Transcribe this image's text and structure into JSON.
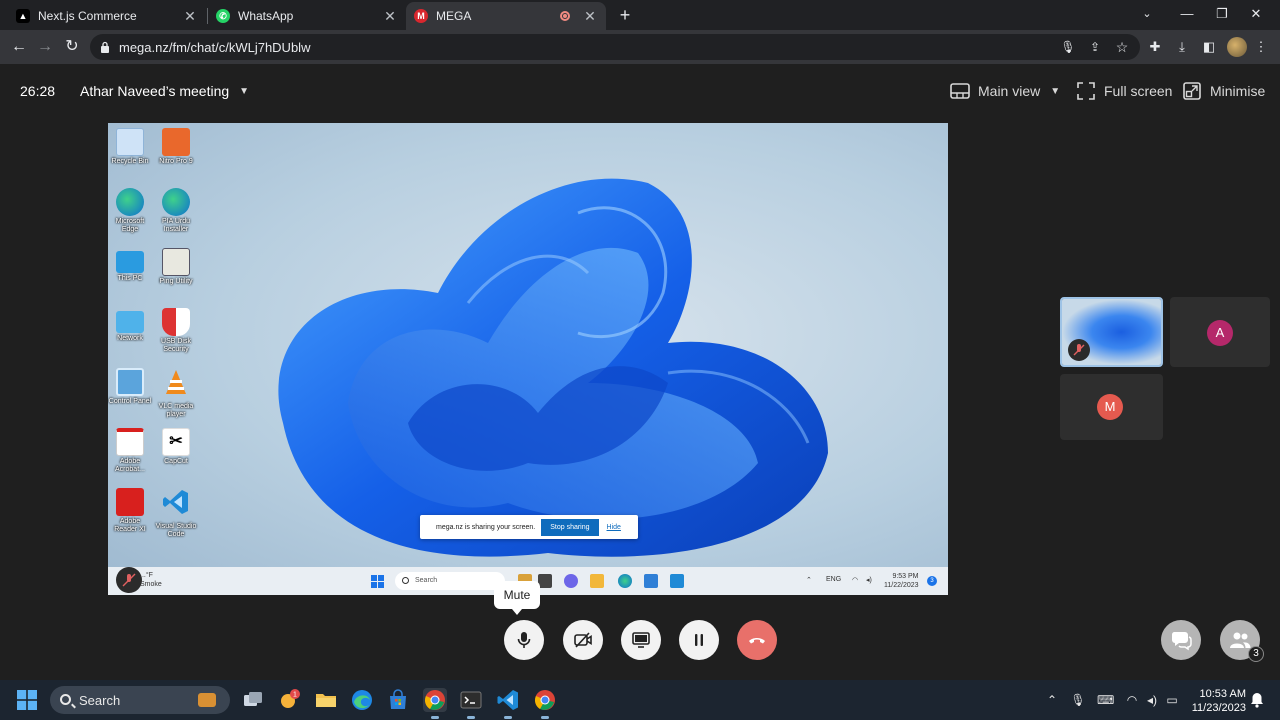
{
  "browser": {
    "tabs": [
      {
        "title": "Next.js Commerce",
        "favicon": "nextjs-icon",
        "active": false
      },
      {
        "title": "WhatsApp",
        "favicon": "whatsapp-icon",
        "active": false
      },
      {
        "title": "MEGA",
        "favicon": "mega-icon",
        "active": true,
        "recording": true
      }
    ],
    "url": "mega.nz/fm/chat/c/kWLj7hDUblw"
  },
  "meeting": {
    "timer": "26:28",
    "title": "Athar Naveed’s meeting",
    "actions": {
      "main_view": "Main view",
      "full_screen": "Full screen",
      "minimise": "Minimise"
    }
  },
  "shared_screen": {
    "desktop_icons": [
      {
        "label": "Recycle Bin",
        "icon": "recycle-bin-icon"
      },
      {
        "label": "Nitro Pro 9",
        "icon": "nitro-pro-icon"
      },
      {
        "label": "Microsoft Edge",
        "icon": "edge-icon"
      },
      {
        "label": "PIA Urdu Installer",
        "icon": "edge-icon"
      },
      {
        "label": "This PC",
        "icon": "this-pc-icon"
      },
      {
        "label": "Ping Utility",
        "icon": "ping-utility-icon"
      },
      {
        "label": "Network",
        "icon": "network-icon"
      },
      {
        "label": "USB Disk Security",
        "icon": "usb-security-icon"
      },
      {
        "label": "Control Panel",
        "icon": "control-panel-icon"
      },
      {
        "label": "VLC media player",
        "icon": "vlc-icon"
      },
      {
        "label": "Adobe Acrobat...",
        "icon": "acrobat-icon"
      },
      {
        "label": "CapCut",
        "icon": "capcut-icon"
      },
      {
        "label": "Adobe Reader XI",
        "icon": "acrobat-icon"
      },
      {
        "label": "Visual Studio Code",
        "icon": "vscode-icon"
      }
    ],
    "sharing_bar": {
      "message": "mega.nz is sharing your screen.",
      "stop": "Stop sharing",
      "hide": "Hide"
    },
    "taskbar": {
      "weather_temp": "...°F",
      "weather_desc": "Smoke",
      "search": "Search",
      "lang": "ENG",
      "time": "9:53 PM",
      "date": "11/22/2023",
      "notifications": "3"
    }
  },
  "participants": [
    {
      "initial": "A",
      "color": "#b5286a"
    },
    {
      "initial": "M",
      "color": "#e55a4f"
    }
  ],
  "controls": {
    "tooltip": "Mute",
    "participant_count": "3"
  },
  "taskbar": {
    "search": "Search",
    "time": "10:53 AM",
    "date": "11/23/2023"
  }
}
